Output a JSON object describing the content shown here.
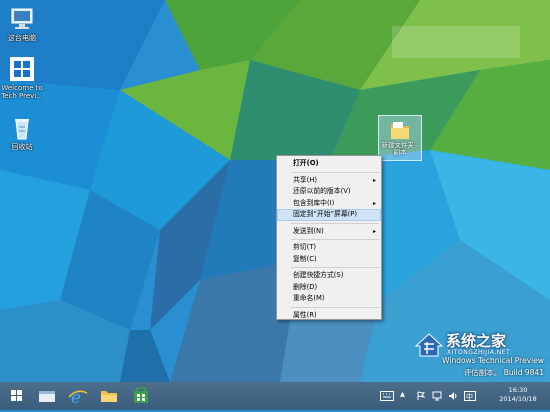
{
  "desktop": {
    "icons": [
      {
        "label": "这台电脑",
        "icon": "computer-icon"
      },
      {
        "label": "Welcome to Tech Previ...",
        "icon": "windows-logo-icon"
      },
      {
        "label": "回收站",
        "icon": "recycle-bin-icon"
      }
    ],
    "folder": {
      "label": "新建文件夹 - 副本",
      "icon": "folder-icon"
    }
  },
  "context_menu": {
    "items": [
      {
        "label": "打开(O)",
        "bold": true
      },
      {
        "sep": true
      },
      {
        "label": "共享(H)",
        "submenu": true
      },
      {
        "label": "还原以前的版本(V)"
      },
      {
        "label": "包含到库中(I)",
        "submenu": true
      },
      {
        "label": "固定到“开始”屏幕(P)",
        "highlighted": true
      },
      {
        "sep": true
      },
      {
        "label": "发送到(N)",
        "submenu": true
      },
      {
        "sep": true
      },
      {
        "label": "剪切(T)"
      },
      {
        "label": "复制(C)"
      },
      {
        "sep": true
      },
      {
        "label": "创建快捷方式(S)"
      },
      {
        "label": "删除(D)"
      },
      {
        "label": "重命名(M)"
      },
      {
        "sep": true
      },
      {
        "label": "属性(R)"
      }
    ],
    "submenu_arrow": "▸"
  },
  "watermark": {
    "line1": "Windows Technical Preview",
    "line2": "评估副本。 Build 9841"
  },
  "logo": {
    "title": "系统之家",
    "url": "XITONGZHIJIA.NET"
  },
  "taskbar": {
    "buttons": [
      "start-button",
      "file-explorer-button",
      "internet-explorer-button",
      "folder-button",
      "store-button"
    ],
    "time": "16:30",
    "date": "2014/10/18"
  },
  "colors": {
    "accent": "#2a8fd0",
    "menu_bg": "#f0f0f0",
    "highlight": "#cfe3f7",
    "taskbar": "#3a5d7c"
  }
}
